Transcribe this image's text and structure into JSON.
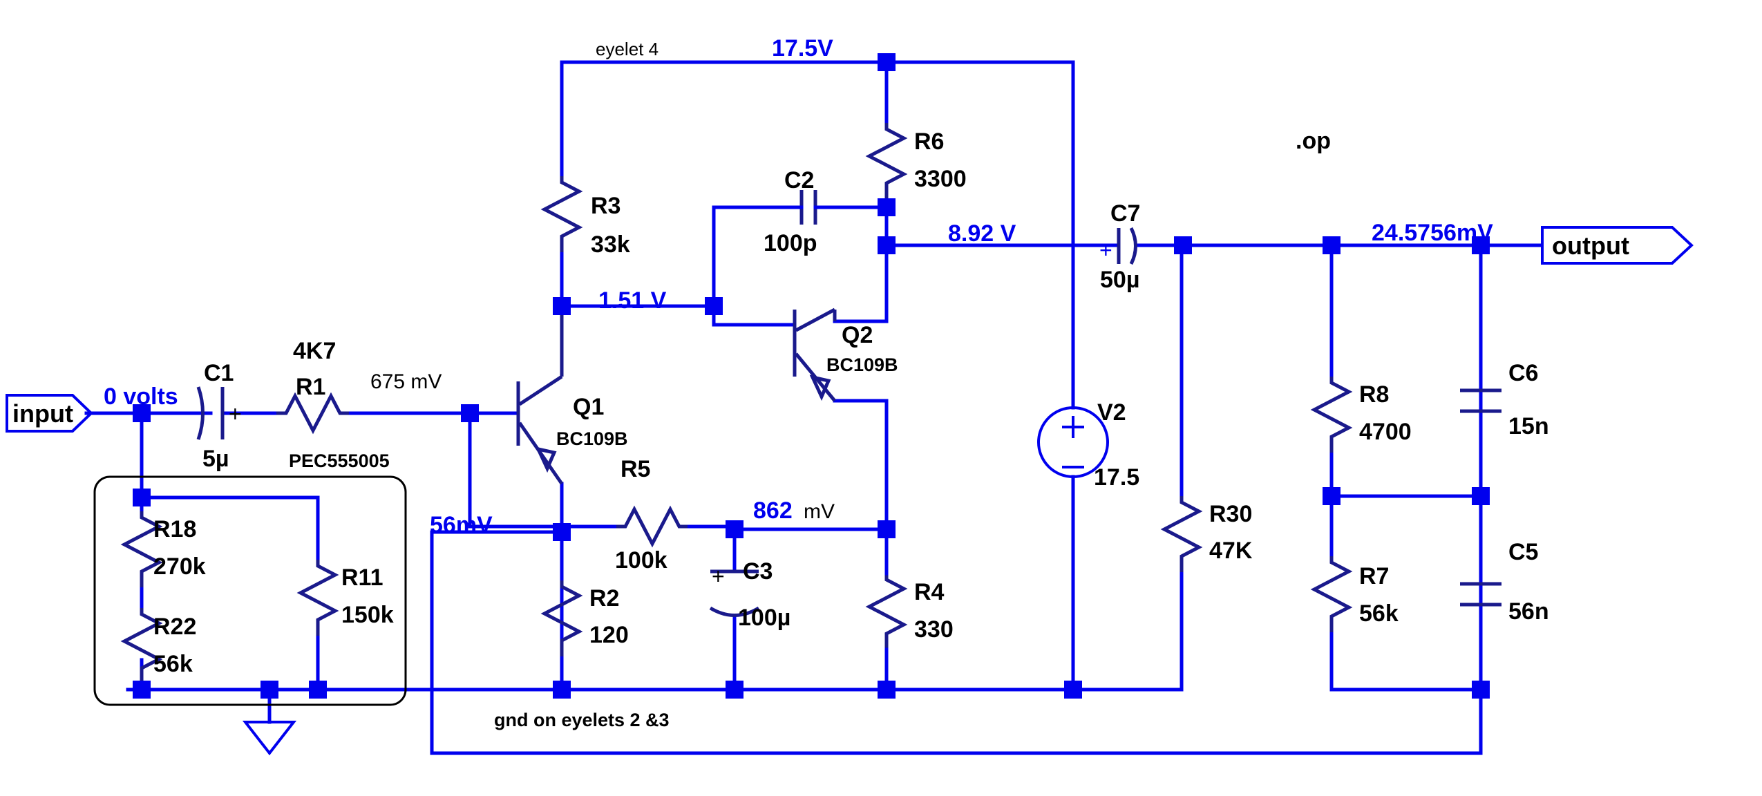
{
  "app": {
    "title": "Circuit Schematic"
  },
  "ports": {
    "input": {
      "label": "input"
    },
    "output": {
      "label": "output"
    }
  },
  "annotations": {
    "eyelet4": "eyelet 4",
    "gnd_note": "gnd on eyelets 2 &3",
    "pec_box": "PEC555005",
    "directive_op": ".op"
  },
  "node_voltages": [
    {
      "name": "input-node",
      "text": "0 volts"
    },
    {
      "name": "supply-rail",
      "text": "17.5V"
    },
    {
      "name": "q1-collector",
      "text": "1.51 V"
    },
    {
      "name": "q2-collector",
      "text": "8.92 V"
    },
    {
      "name": "output-node",
      "text": "24.5756mV"
    },
    {
      "name": "q1-base",
      "text": "675 mV"
    },
    {
      "name": "q1-emitter",
      "text": "56mV"
    },
    {
      "name": "c3-node-value",
      "text": "862"
    },
    {
      "name": "c3-node-unit",
      "text": "mV"
    }
  ],
  "components": {
    "resistors": [
      {
        "ref": "R1",
        "value": "4K7"
      },
      {
        "ref": "R2",
        "value": "120"
      },
      {
        "ref": "R3",
        "value": "33k"
      },
      {
        "ref": "R4",
        "value": "330"
      },
      {
        "ref": "R5",
        "value": "100k"
      },
      {
        "ref": "R6",
        "value": "3300"
      },
      {
        "ref": "R7",
        "value": "56k"
      },
      {
        "ref": "R8",
        "value": "4700"
      },
      {
        "ref": "R11",
        "value": "150k"
      },
      {
        "ref": "R18",
        "value": "270k"
      },
      {
        "ref": "R22",
        "value": "56k"
      },
      {
        "ref": "R30",
        "value": "47K"
      }
    ],
    "capacitors": [
      {
        "ref": "C1",
        "value": "5µ",
        "polarized": true,
        "plus": "+"
      },
      {
        "ref": "C2",
        "value": "100p",
        "polarized": false
      },
      {
        "ref": "C3",
        "value": "100µ",
        "polarized": true,
        "plus": "+"
      },
      {
        "ref": "C5",
        "value": "56n",
        "polarized": false
      },
      {
        "ref": "C6",
        "value": "15n",
        "polarized": false
      },
      {
        "ref": "C7",
        "value": "50µ",
        "polarized": true,
        "plus": "+"
      }
    ],
    "transistors": [
      {
        "ref": "Q1",
        "model": "BC109B",
        "type": "npn"
      },
      {
        "ref": "Q2",
        "model": "BC109B",
        "type": "npn"
      }
    ],
    "sources": [
      {
        "ref": "V2",
        "value": "17.5",
        "plus": "+",
        "minus": "−"
      }
    ]
  },
  "colors": {
    "wire": "#0000ee",
    "symbol": "#1a1a8c",
    "label": "#000000",
    "voltage": "#0000ee",
    "background": "#ffffff"
  }
}
